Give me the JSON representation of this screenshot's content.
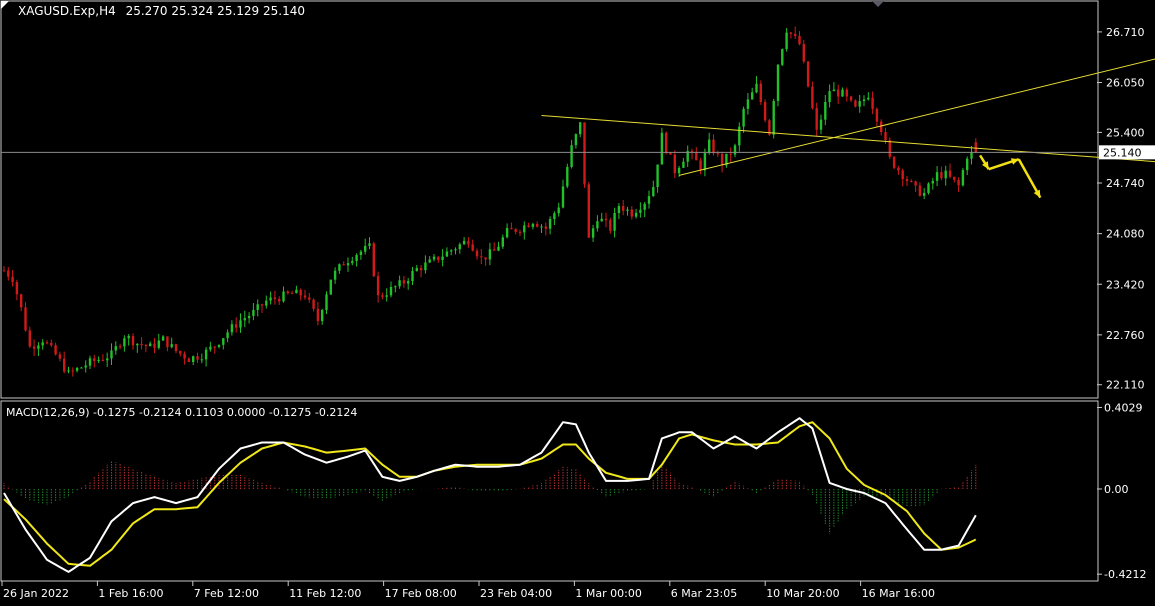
{
  "colors": {
    "background": "#000000",
    "frame": "#c8c8c8",
    "text": "#ffffff",
    "bull": "#22c02a",
    "bear": "#d01a1a",
    "trendline": "#e6dc33",
    "arrow": "#f4e010",
    "price_line": "#8c8c8c",
    "macd_line": "#ffffff",
    "signal_line": "#f0e81a",
    "hist_pos": "#c03030",
    "hist_neg": "#1e8c2a"
  },
  "header": {
    "symbol_label": "XAGUSD.Exp,H4",
    "ohlc_label": "25.270 25.324 25.129 25.140"
  },
  "current_price_label": "25.140",
  "macd_header": "MACD(12,26,9) -0.1275 -0.2124 0.1103 0.0000 -0.1275 -0.2124",
  "chart_data": [
    {
      "type": "candlestick",
      "title": "XAGUSD.Exp,H4",
      "last_ohlc": {
        "open": 25.27,
        "high": 25.324,
        "low": 25.129,
        "close": 25.14
      },
      "current_price": 25.14,
      "ylim": [
        21.95,
        27.1
      ],
      "yticks": [
        22.11,
        22.76,
        23.42,
        24.08,
        24.74,
        25.4,
        26.05,
        26.71
      ],
      "ytick_labels": [
        "22.110",
        "22.760",
        "23.420",
        "24.080",
        "24.740",
        "25.400",
        "26.050",
        "26.710"
      ],
      "x_labels": [
        "26 Jan 2022",
        "1 Feb 16:00",
        "7 Feb 12:00",
        "11 Feb 12:00",
        "17 Feb 08:00",
        "23 Feb 04:00",
        "1 Mar 00:00",
        "6 Mar 23:05",
        "10 Mar 20:00",
        "16 Mar 16:00"
      ],
      "price_anchors": [
        [
          0,
          23.6
        ],
        [
          2,
          23.5
        ],
        [
          4,
          23.1
        ],
        [
          6,
          22.6
        ],
        [
          9,
          22.7
        ],
        [
          12,
          22.5
        ],
        [
          15,
          22.25
        ],
        [
          20,
          22.4
        ],
        [
          25,
          22.5
        ],
        [
          28,
          22.75
        ],
        [
          31,
          22.65
        ],
        [
          34,
          22.6
        ],
        [
          37,
          22.7
        ],
        [
          40,
          22.55
        ],
        [
          43,
          22.45
        ],
        [
          46,
          22.5
        ],
        [
          49,
          22.62
        ],
        [
          52,
          22.8
        ],
        [
          55,
          22.95
        ],
        [
          58,
          23.05
        ],
        [
          61,
          23.2
        ],
        [
          64,
          23.25
        ],
        [
          67,
          23.3
        ],
        [
          70,
          23.28
        ],
        [
          73,
          22.95
        ],
        [
          76,
          23.5
        ],
        [
          79,
          23.7
        ],
        [
          82,
          23.82
        ],
        [
          85,
          23.9
        ],
        [
          87,
          23.25
        ],
        [
          90,
          23.35
        ],
        [
          93,
          23.45
        ],
        [
          96,
          23.62
        ],
        [
          99,
          23.7
        ],
        [
          102,
          23.8
        ],
        [
          105,
          23.9
        ],
        [
          108,
          24.0
        ],
        [
          111,
          23.75
        ],
        [
          114,
          23.85
        ],
        [
          117,
          24.1
        ],
        [
          120,
          24.15
        ],
        [
          123,
          24.25
        ],
        [
          126,
          24.15
        ],
        [
          129,
          24.45
        ],
        [
          132,
          25.2
        ],
        [
          134,
          25.5
        ],
        [
          136,
          24.0
        ],
        [
          138,
          24.3
        ],
        [
          141,
          24.15
        ],
        [
          143,
          24.45
        ],
        [
          146,
          24.35
        ],
        [
          149,
          24.5
        ],
        [
          151,
          24.7
        ],
        [
          153,
          25.35
        ],
        [
          156,
          24.9
        ],
        [
          159,
          25.15
        ],
        [
          162,
          24.95
        ],
        [
          164,
          25.25
        ],
        [
          167,
          25.0
        ],
        [
          170,
          25.2
        ],
        [
          172,
          25.7
        ],
        [
          175,
          26.0
        ],
        [
          178,
          25.4
        ],
        [
          180,
          26.3
        ],
        [
          182,
          26.75
        ],
        [
          185,
          26.55
        ],
        [
          187,
          26.0
        ],
        [
          189,
          25.4
        ],
        [
          192,
          25.95
        ],
        [
          195,
          25.9
        ],
        [
          198,
          25.7
        ],
        [
          201,
          25.9
        ],
        [
          204,
          25.45
        ],
        [
          206,
          25.05
        ],
        [
          209,
          24.85
        ],
        [
          212,
          24.65
        ],
        [
          214,
          24.6
        ],
        [
          217,
          24.85
        ],
        [
          219,
          24.85
        ],
        [
          222,
          24.7
        ],
        [
          224,
          25.1
        ],
        [
          226,
          25.14
        ]
      ],
      "trendlines": [
        {
          "from": [
            125,
            25.62
          ],
          "to": [
            284,
            24.95
          ]
        },
        {
          "from": [
            157,
            24.84
          ],
          "to": [
            284,
            26.58
          ]
        }
      ],
      "arrows": [
        {
          "from": [
            227,
            25.1
          ],
          "to": [
            229,
            24.92
          ]
        },
        {
          "from": [
            229,
            24.92
          ],
          "to": [
            236,
            25.05
          ]
        },
        {
          "from": [
            236,
            25.05
          ],
          "to": [
            241,
            24.55
          ]
        }
      ]
    },
    {
      "type": "macd",
      "title": "MACD(12,26,9)",
      "values": {
        "macd": -0.1275,
        "signal": -0.2124,
        "histogram": 0.1103
      },
      "ylim": [
        -0.45,
        0.43
      ],
      "yticks": [
        -0.4212,
        0.0,
        0.4029
      ],
      "ytick_labels": [
        "-0.4212",
        "0.00",
        "0.4029"
      ],
      "macd_anchors": [
        [
          0,
          -0.02
        ],
        [
          5,
          -0.2
        ],
        [
          10,
          -0.35
        ],
        [
          15,
          -0.41
        ],
        [
          20,
          -0.34
        ],
        [
          25,
          -0.16
        ],
        [
          30,
          -0.07
        ],
        [
          35,
          -0.04
        ],
        [
          40,
          -0.07
        ],
        [
          45,
          -0.04
        ],
        [
          50,
          0.1
        ],
        [
          55,
          0.2
        ],
        [
          60,
          0.23
        ],
        [
          65,
          0.23
        ],
        [
          70,
          0.17
        ],
        [
          75,
          0.13
        ],
        [
          80,
          0.16
        ],
        [
          84,
          0.19
        ],
        [
          88,
          0.06
        ],
        [
          92,
          0.04
        ],
        [
          96,
          0.06
        ],
        [
          100,
          0.09
        ],
        [
          105,
          0.12
        ],
        [
          110,
          0.11
        ],
        [
          115,
          0.11
        ],
        [
          120,
          0.12
        ],
        [
          125,
          0.18
        ],
        [
          130,
          0.33
        ],
        [
          133,
          0.32
        ],
        [
          136,
          0.18
        ],
        [
          140,
          0.04
        ],
        [
          145,
          0.04
        ],
        [
          150,
          0.05
        ],
        [
          153,
          0.25
        ],
        [
          157,
          0.28
        ],
        [
          160,
          0.28
        ],
        [
          165,
          0.2
        ],
        [
          170,
          0.26
        ],
        [
          175,
          0.2
        ],
        [
          180,
          0.28
        ],
        [
          185,
          0.35
        ],
        [
          188,
          0.3
        ],
        [
          192,
          0.03
        ],
        [
          196,
          0.0
        ],
        [
          200,
          -0.02
        ],
        [
          205,
          -0.07
        ],
        [
          210,
          -0.2
        ],
        [
          214,
          -0.3
        ],
        [
          218,
          -0.3
        ],
        [
          222,
          -0.28
        ],
        [
          226,
          -0.13
        ]
      ],
      "signal_anchors": [
        [
          0,
          -0.05
        ],
        [
          5,
          -0.15
        ],
        [
          10,
          -0.27
        ],
        [
          15,
          -0.37
        ],
        [
          20,
          -0.38
        ],
        [
          25,
          -0.3
        ],
        [
          30,
          -0.17
        ],
        [
          35,
          -0.1
        ],
        [
          40,
          -0.1
        ],
        [
          45,
          -0.09
        ],
        [
          50,
          0.03
        ],
        [
          55,
          0.13
        ],
        [
          60,
          0.2
        ],
        [
          65,
          0.23
        ],
        [
          70,
          0.21
        ],
        [
          75,
          0.18
        ],
        [
          80,
          0.19
        ],
        [
          84,
          0.2
        ],
        [
          88,
          0.12
        ],
        [
          92,
          0.06
        ],
        [
          96,
          0.06
        ],
        [
          100,
          0.09
        ],
        [
          105,
          0.11
        ],
        [
          110,
          0.12
        ],
        [
          115,
          0.12
        ],
        [
          120,
          0.12
        ],
        [
          125,
          0.15
        ],
        [
          130,
          0.22
        ],
        [
          133,
          0.22
        ],
        [
          136,
          0.15
        ],
        [
          140,
          0.08
        ],
        [
          145,
          0.05
        ],
        [
          150,
          0.05
        ],
        [
          153,
          0.12
        ],
        [
          157,
          0.25
        ],
        [
          160,
          0.27
        ],
        [
          165,
          0.24
        ],
        [
          170,
          0.22
        ],
        [
          175,
          0.22
        ],
        [
          180,
          0.23
        ],
        [
          185,
          0.31
        ],
        [
          188,
          0.33
        ],
        [
          192,
          0.25
        ],
        [
          196,
          0.1
        ],
        [
          200,
          0.02
        ],
        [
          205,
          -0.03
        ],
        [
          210,
          -0.11
        ],
        [
          214,
          -0.22
        ],
        [
          218,
          -0.3
        ],
        [
          222,
          -0.29
        ],
        [
          226,
          -0.25
        ]
      ]
    }
  ]
}
